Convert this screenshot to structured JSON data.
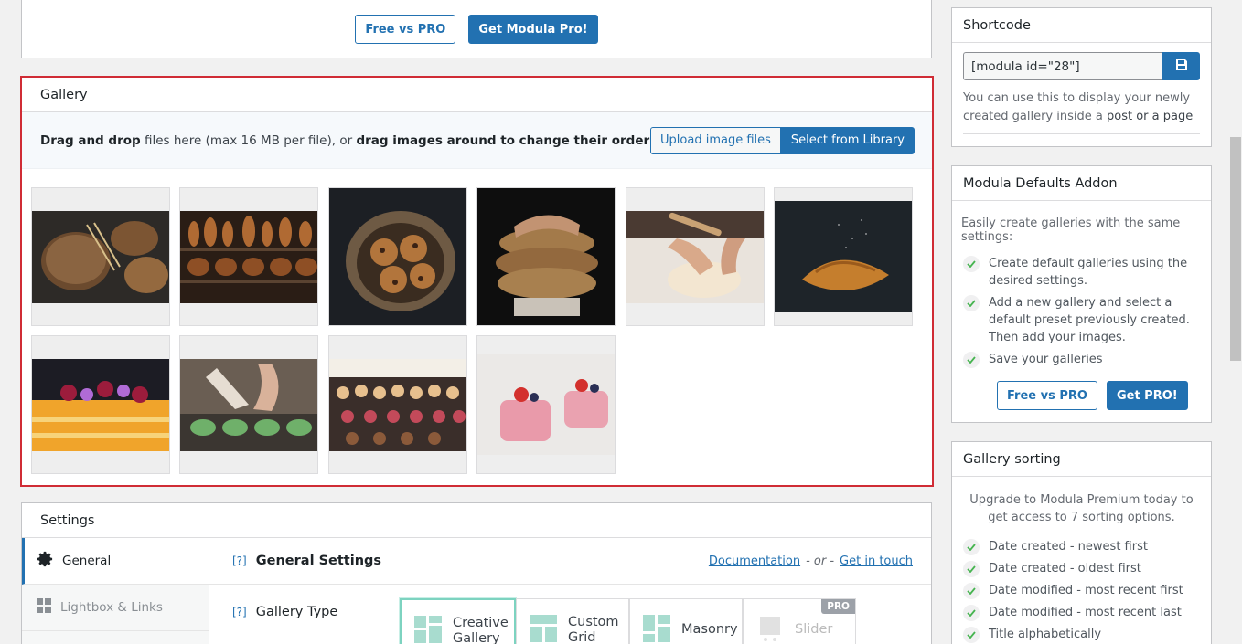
{
  "top_box": {
    "free_vs_pro": "Free vs PRO",
    "get_pro": "Get Modula Pro!"
  },
  "gallery": {
    "title": "Gallery",
    "drop_bold1": "Drag and drop",
    "drop_mid": " files here (max 16 MB per file), or ",
    "drop_bold2": "drag images around to change their order",
    "upload_label": "Upload image files",
    "library_label": "Select from Library",
    "images": [
      "rustic-bread-loaves",
      "bread-shelves",
      "chocolate-chip-cookies",
      "stacked-bread-hands",
      "kneading-dough",
      "croissants",
      "fruit-pastry",
      "piping-macarons",
      "pastry-display-case",
      "pink-mousse-cakes"
    ]
  },
  "settings": {
    "title": "Settings",
    "tabs": [
      {
        "label": "General"
      },
      {
        "label": "Lightbox & Links"
      }
    ],
    "help": "[?]",
    "section_title": "General Settings",
    "documentation": "Documentation",
    "or": "- or -",
    "get_in_touch": "Get in touch",
    "gallery_type_label": "Gallery Type",
    "gallery_types": [
      {
        "line1": "Creative",
        "line2": "Gallery"
      },
      {
        "line1": "Custom",
        "line2": "Grid"
      },
      {
        "line1": "Masonry",
        "line2": ""
      },
      {
        "line1": "Slider",
        "line2": ""
      }
    ],
    "pro_badge": "PRO"
  },
  "shortcode": {
    "title": "Shortcode",
    "value": "[modula id=\"28\"]",
    "desc": "You can use this to display your newly created gallery inside a ",
    "link": "post or a page"
  },
  "defaults_addon": {
    "title": "Modula Defaults Addon",
    "intro": "Easily create galleries with the same settings:",
    "items": [
      "Create default galleries using the desired settings.",
      "Add a new gallery and select a default preset previously created. Then add your images.",
      "Save your galleries"
    ],
    "free_vs_pro": "Free vs PRO",
    "get_pro": "Get PRO!"
  },
  "sorting": {
    "title": "Gallery sorting",
    "intro": "Upgrade to Modula Premium today to get access to 7 sorting options.",
    "items": [
      "Date created - newest first",
      "Date created - oldest first",
      "Date modified - most recent first",
      "Date modified - most recent last",
      "Title alphabetically"
    ]
  },
  "colors": {
    "accent": "#2271b1",
    "highlight_border": "#d02c35",
    "check_green": "#46b450"
  }
}
